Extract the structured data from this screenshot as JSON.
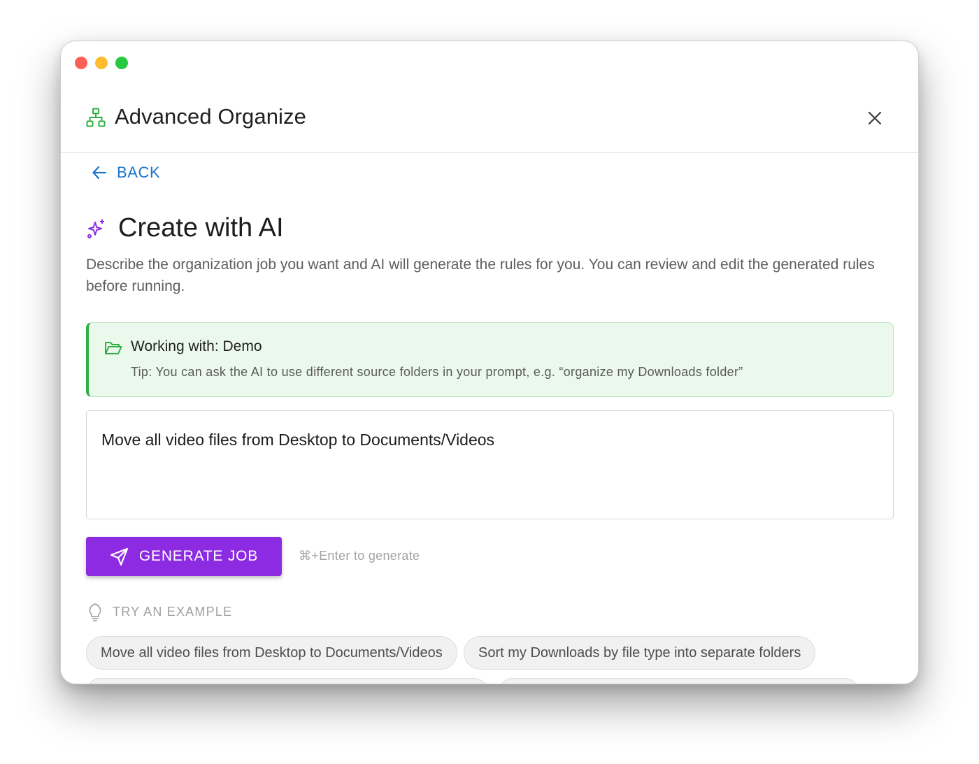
{
  "header": {
    "title": "Advanced Organize",
    "icon": "sitemap-icon",
    "accent": "#2eb043"
  },
  "nav": {
    "back_label": "BACK"
  },
  "section": {
    "title": "Create with AI",
    "icon": "sparkles-icon",
    "description": "Describe the organization job you want and AI will generate the rules for you. You can review and edit the generated rules before running."
  },
  "info": {
    "title": "Working with: Demo",
    "tip": "Tip: You can ask the AI to use different source folders in your prompt, e.g. “organize my Downloads folder”",
    "icon": "folder-open-icon"
  },
  "prompt": {
    "value": "Move all video files from Desktop to Documents/Videos"
  },
  "actions": {
    "generate_label": "GENERATE JOB",
    "shortcut_hint": "⌘+Enter to generate",
    "button_color": "#8d2be2"
  },
  "examples": {
    "label": "TRY AN EXAMPLE",
    "items": [
      "Move all video files from Desktop to Documents/Videos",
      "Sort my Downloads by file type into separate folders"
    ]
  }
}
